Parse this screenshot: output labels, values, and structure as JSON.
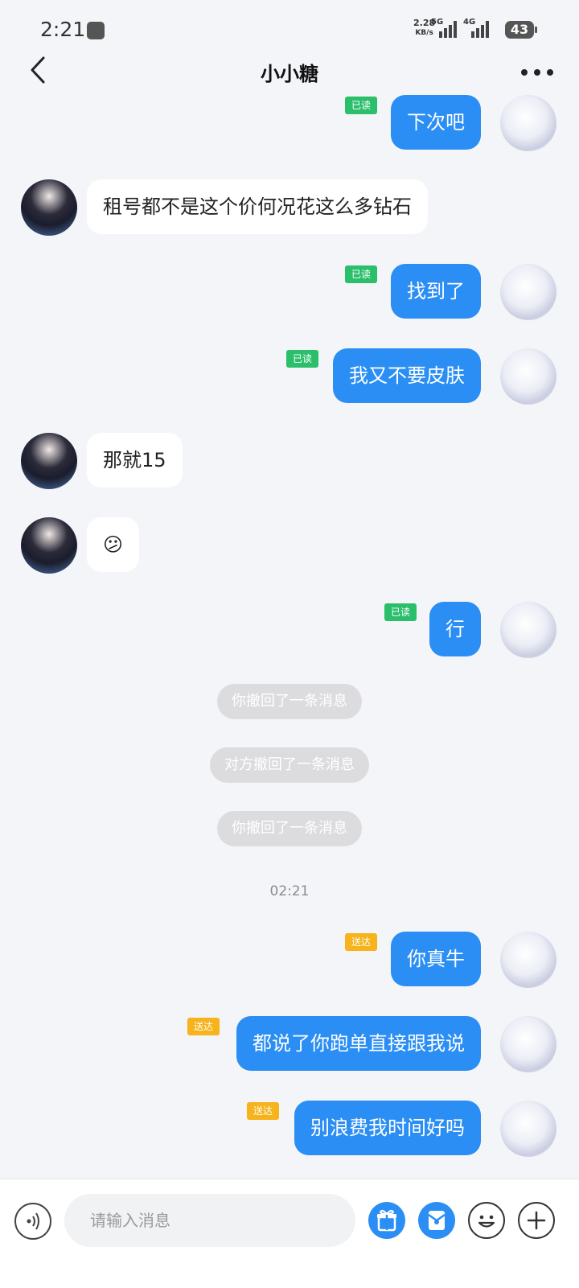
{
  "status_bar": {
    "time": "2:21",
    "speed_value": "2.28",
    "speed_unit": "KB/s",
    "net1": "5G",
    "net2": "4G",
    "battery": "43"
  },
  "header": {
    "title": "小小糖"
  },
  "messages": [
    {
      "side": "me",
      "text": "下次吧",
      "receipt": "已读",
      "receipt_type": "read"
    },
    {
      "side": "other",
      "text": "租号都不是这个价何况花这么多钻石"
    },
    {
      "side": "me",
      "text": "找到了",
      "receipt": "已读",
      "receipt_type": "read"
    },
    {
      "side": "me",
      "text": "我又不要皮肤",
      "receipt": "已读",
      "receipt_type": "read"
    },
    {
      "side": "other",
      "text": "那就15"
    },
    {
      "side": "other",
      "text": "😕"
    },
    {
      "side": "me",
      "text": "行",
      "receipt": "已读",
      "receipt_type": "read"
    },
    {
      "side": "me",
      "text": "你真牛",
      "receipt": "送达",
      "receipt_type": "delivered"
    },
    {
      "side": "me",
      "text": "都说了你跑单直接跟我说",
      "receipt": "送达",
      "receipt_type": "delivered"
    },
    {
      "side": "me",
      "text": "别浪费我时间好吗",
      "receipt": "送达",
      "receipt_type": "delivered"
    }
  ],
  "system_notices": [
    "你撤回了一条消息",
    "对方撤回了一条消息",
    "你撤回了一条消息"
  ],
  "timestamp": "02:21",
  "input_bar": {
    "placeholder": "请输入消息"
  },
  "colors": {
    "bubble_me": "#2a8ef4",
    "read_badge": "#2bbf6c",
    "delivered_badge": "#f6b31b",
    "background": "#f4f5f8"
  }
}
